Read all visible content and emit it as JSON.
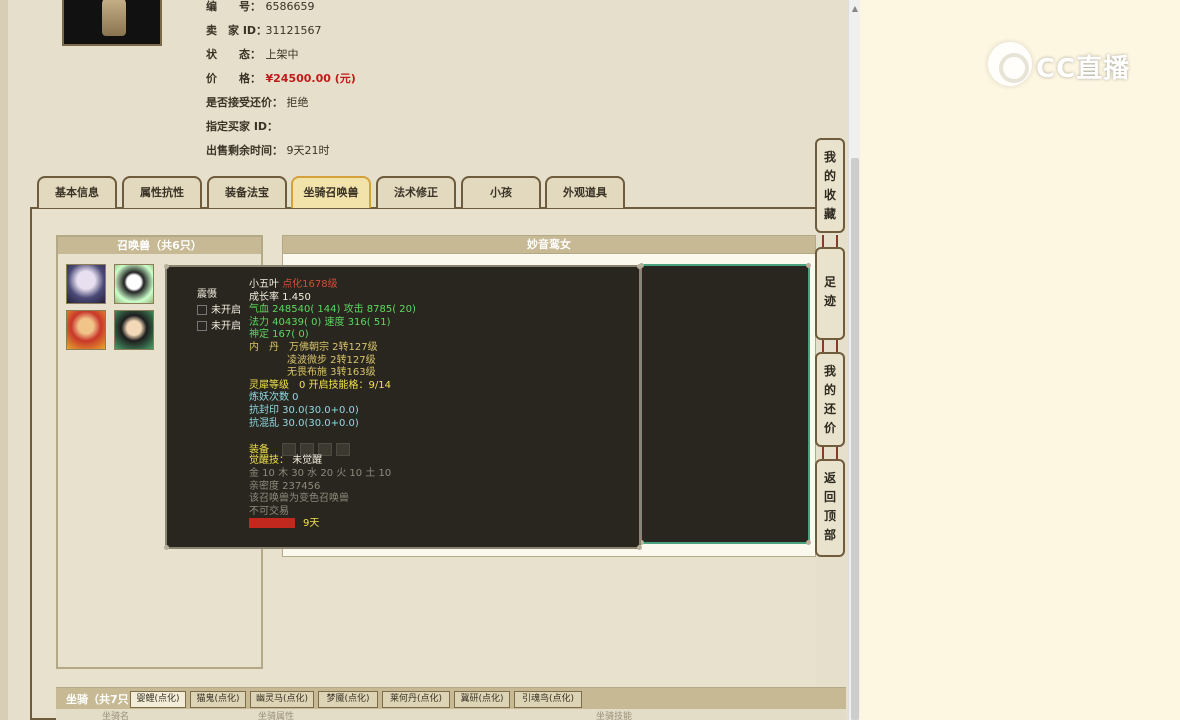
{
  "seller_info": {
    "rows": [
      {
        "label": "编　　号：",
        "value": "6586659"
      },
      {
        "label": "卖　家 ID：",
        "value": "31121567"
      },
      {
        "label": "状　　态：",
        "value": "上架中"
      },
      {
        "label": "价　　格：",
        "value": "¥24500.00 (元)"
      },
      {
        "label": "是否接受还价：",
        "value": "拒绝"
      },
      {
        "label": "指定买家 ID：",
        "value": ""
      },
      {
        "label": "出售剩余时间：",
        "value": "9天21时"
      }
    ]
  },
  "tabs": [
    "基本信息",
    "属性抗性",
    "装备法宝",
    "坐骑召唤兽",
    "法术修正",
    "小孩",
    "外观道具"
  ],
  "active_tab": "坐骑召唤兽",
  "pet_list": {
    "header": "召唤兽（共6只）"
  },
  "detail_panel": {
    "header": "妙音鸾女"
  },
  "tooltip": {
    "side": [
      "震慑",
      "未开启",
      "未开启"
    ],
    "name": "小五叶",
    "name_suffix": "点化1678级",
    "growth": "成长率 1.450",
    "hp_atk": "气血 248540( 144) 攻击 8785( 20)",
    "mp_spd": "法力 40439( 0) 速度 316( 51)",
    "def": "神定 167( 0)",
    "neidan1": "内　丹　万佛朝宗 2转127级",
    "neidan2": "凌波微步 2转127级",
    "neidan3": "无畏布施 3转163级",
    "spirit": "灵犀等级　0 开启技能格：9/14",
    "refine": "炼妖次数 0",
    "resist1": "抗封印 30.0(30.0+0.0)",
    "resist2": "抗混乱 30.0(30.0+0.0)",
    "equip": "装备",
    "awaken_label": "觉醒技：",
    "awaken_value": "未觉醒",
    "elements": "金 10 木 30 水 20 火 10 土 10",
    "bond": "亲密度 237456",
    "bound": "该召唤兽为变色召唤兽",
    "trade": "不可交易",
    "days": "9天"
  },
  "side_buttons": [
    {
      "name": "favorites",
      "chars": [
        "我",
        "的",
        "收",
        "藏"
      ]
    },
    {
      "name": "footprints",
      "chars": [
        "足",
        "迹"
      ]
    },
    {
      "name": "my-offers",
      "chars": [
        "我",
        "的",
        "还",
        "价"
      ]
    },
    {
      "name": "back-to-top",
      "chars": [
        "返",
        "回",
        "顶",
        "部"
      ]
    }
  ],
  "mounts": {
    "label": "坐骑（共7只",
    "tabs": [
      "婴鲤(点化)",
      "猫鬼(点化)",
      "幽灵马(点化)",
      "梦魇(点化)",
      "莱何丹(点化)",
      "冀研(点化)",
      "引魂鸟(点化)"
    ],
    "sub_cols": [
      "坐骑名",
      "坐骑属性",
      "坐骑技能"
    ]
  },
  "logo": {
    "text": "CC直播"
  }
}
